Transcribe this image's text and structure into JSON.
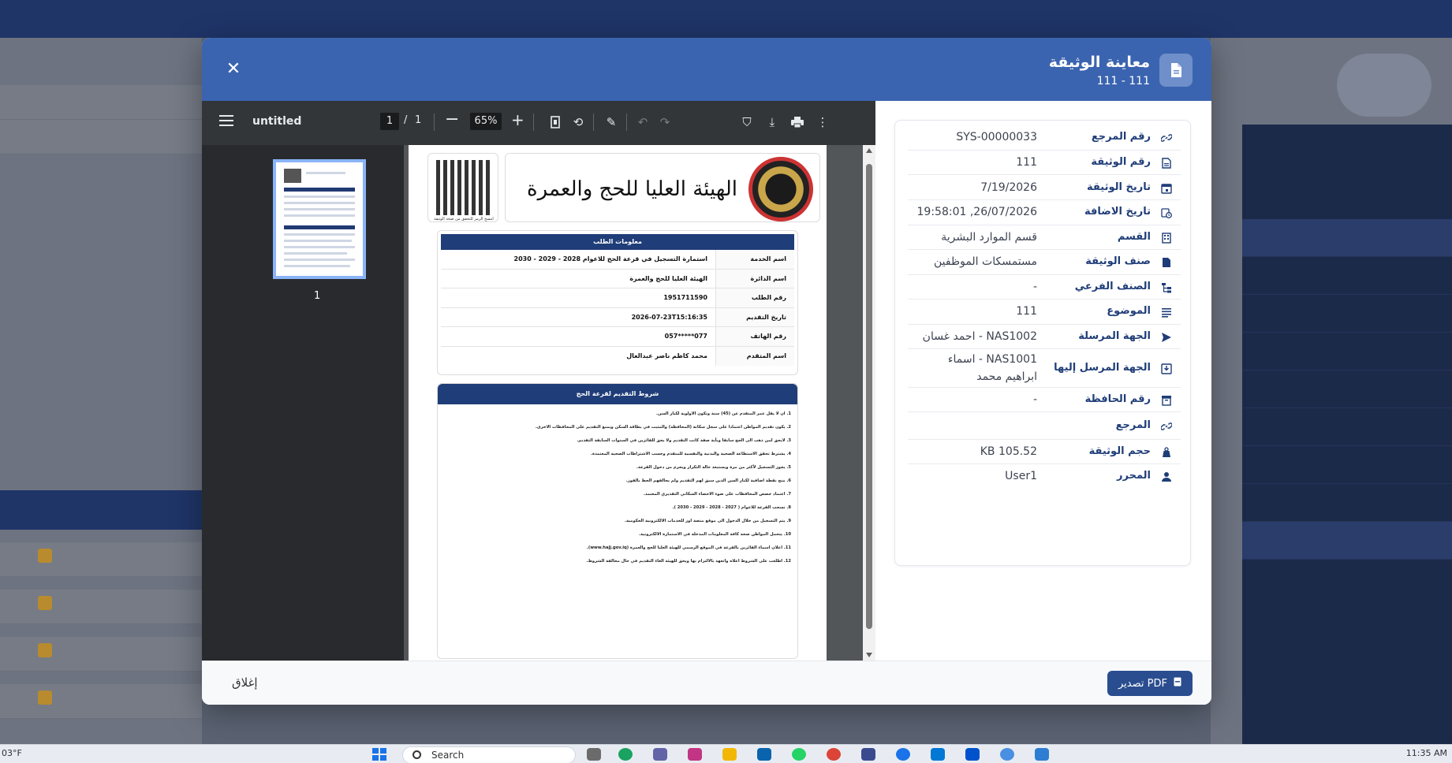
{
  "modal": {
    "title": "معاينة الوثيقة",
    "subtitle": "111 - 111",
    "close_icon": "close-icon",
    "header_icon": "document-icon"
  },
  "viewer": {
    "file_title": "untitled",
    "current_page": "1",
    "page_separator": "/",
    "total_pages": "1",
    "zoom": "65%",
    "thumbnail_label": "1"
  },
  "pdf_page": {
    "qr_caption": "امسح الرمز للتحقق من صحة الوثيقة",
    "header_calligraphy": "الهيئة العليا للحج والعمرة",
    "info_title": "معلومات الطلب",
    "info_rows": [
      {
        "key": "اسم الخدمة",
        "value": "استمارة التسجيل في قرعة الحج للاعوام 2028 - 2029 - 2030"
      },
      {
        "key": "اسم الدائرة",
        "value": "الهيئة العليا للحج والعمرة"
      },
      {
        "key": "رقم الطلب",
        "value": "1951711590"
      },
      {
        "key": "تاريخ التقديم",
        "value": "2026-07-23T15:16:35"
      },
      {
        "key": "رقم الهاتف",
        "value": "077*****057"
      },
      {
        "key": "اسم المتقدم",
        "value": "محمد كاظم ناصر عبدالعال"
      }
    ],
    "terms_title": "شروط التقديم لقرعة الحج",
    "terms": [
      "1. ان لا يقل عمر المتقدم عن (45) سنة وتكون الاولوية لكبار السن.",
      "2. يكون تقديم المواطن اعتمادا على سجل سكانه (المحافظة) والمثبت في بطاقة السكن ويمنع التقديم على المحافظات الاخرى.",
      "3. لايحق لمن ذهب الى الحج سابقا وبأية صفة كانت التقديم ولا يحق للفائزين في السنوات السابقة التقديم.",
      "4. يشترط تحقق الاستطاعة الصحية والبدنية والنفسية للمتقدم وحسب الاشتراطات الصحية المعتمدة.",
      "5. يجوز التسجيل لأكثر من مرة ويستبعد حالة التكرار ويحرم من دخول القرعة.",
      "6. منح نقطة اضافية لكبار السن الذين سبق لهم التقديم ولم يحالفهم الحظ بالفوز.",
      "7. اعتماد حصص المحافظات على ضوء الاحصاء السكاني التقديري المعتمد.",
      "8. تسحب القرعة للاعوام ( 2027 - 2028 - 2029 - 2030 ).",
      "9. يتم التسجيل من خلال الدخول الى موقع منصة اور للخدمات الالكترونية الحكومية.",
      "10. يتحمل المواطن صحة كافة المعلومات المدخلة في الاستمارة الالكترونية.",
      "11. اعلان اسماء الفائزين بالقرعة في الموقع الرسمي للهيئة العليا للحج والعمرة (www.hajj.gov.iq).",
      "12. اطلعت على الشروط اعلاه واتعهد بالالتزام بها ويحق للهيئة الغاء التقديم في حال مخالفة الشروط."
    ]
  },
  "details": {
    "rows": [
      {
        "label": "رقم المرجع",
        "value": "SYS-00000033",
        "icon": "link-icon"
      },
      {
        "label": "رقم الوثيقة",
        "value": "111",
        "icon": "document-icon"
      },
      {
        "label": "تاريخ الوثيقة",
        "value": "7/19/2026",
        "icon": "calendar-icon"
      },
      {
        "label": "تاريخ الاضافة",
        "value": "26/07/2026, 19:58:01",
        "icon": "calendar-clock-icon"
      },
      {
        "label": "القسم",
        "value": "قسم الموارد البشرية",
        "icon": "building-icon"
      },
      {
        "label": "صنف الوثيقة",
        "value": "مستمسكات الموظفين",
        "icon": "file-icon"
      },
      {
        "label": "الصنف الفرعي",
        "value": "-",
        "icon": "tree-icon"
      },
      {
        "label": "الموضوع",
        "value": "111",
        "icon": "subject-lines-icon"
      },
      {
        "label": "الجهة المرسلة",
        "value": "NAS1002 - احمد غسان",
        "icon": "send-icon"
      },
      {
        "label": "الجهة المرسل إليها",
        "value": "NAS1001 - اسماء ابراهيم محمد",
        "icon": "inbox-icon"
      },
      {
        "label": "رقم الحافظة",
        "value": "-",
        "icon": "archive-icon"
      },
      {
        "label": "المرجع",
        "value": "",
        "icon": "link-icon"
      },
      {
        "label": "حجم الوثيقة",
        "value": "105.52 KB",
        "icon": "weight-icon"
      },
      {
        "label": "المحرر",
        "value": "User1",
        "icon": "user-icon"
      }
    ]
  },
  "footer": {
    "close_label": "إغلاق",
    "export_label": "تصدير PDF"
  },
  "taskbar": {
    "weather": "03°F",
    "search_placeholder": "Search",
    "clock": "11:35 AM"
  },
  "colors": {
    "header": "#3b64b0",
    "accent": "#1f3d78",
    "export_button": "#2a4d8f"
  }
}
